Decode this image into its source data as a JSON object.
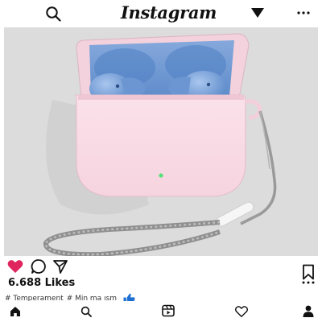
{
  "app": {
    "title": "Instagram"
  },
  "header": {
    "icons": {
      "search": "search-icon",
      "dropdown": "caret-down-icon",
      "more": "more-horizontal-icon"
    }
  },
  "post": {
    "image_description_icon": "airpods-case-photo",
    "liked": true,
    "like_color": "#e0245e",
    "likes_label": "6.688 Likes",
    "hashtags": [
      "# Temperament",
      "# Min ma ısm"
    ]
  },
  "nav": {
    "items": [
      {
        "name": "home",
        "icon": "home-icon"
      },
      {
        "name": "search",
        "icon": "search-icon"
      },
      {
        "name": "reels",
        "icon": "reels-icon"
      },
      {
        "name": "activity",
        "icon": "heart-icon"
      },
      {
        "name": "profile",
        "icon": "profile-icon"
      }
    ]
  },
  "colors": {
    "case_pink": "#f8dbe5",
    "case_blue": "#6f9ad3",
    "photo_bg": "#dcdcdc",
    "thumb_blue": "#1c6fd0"
  }
}
